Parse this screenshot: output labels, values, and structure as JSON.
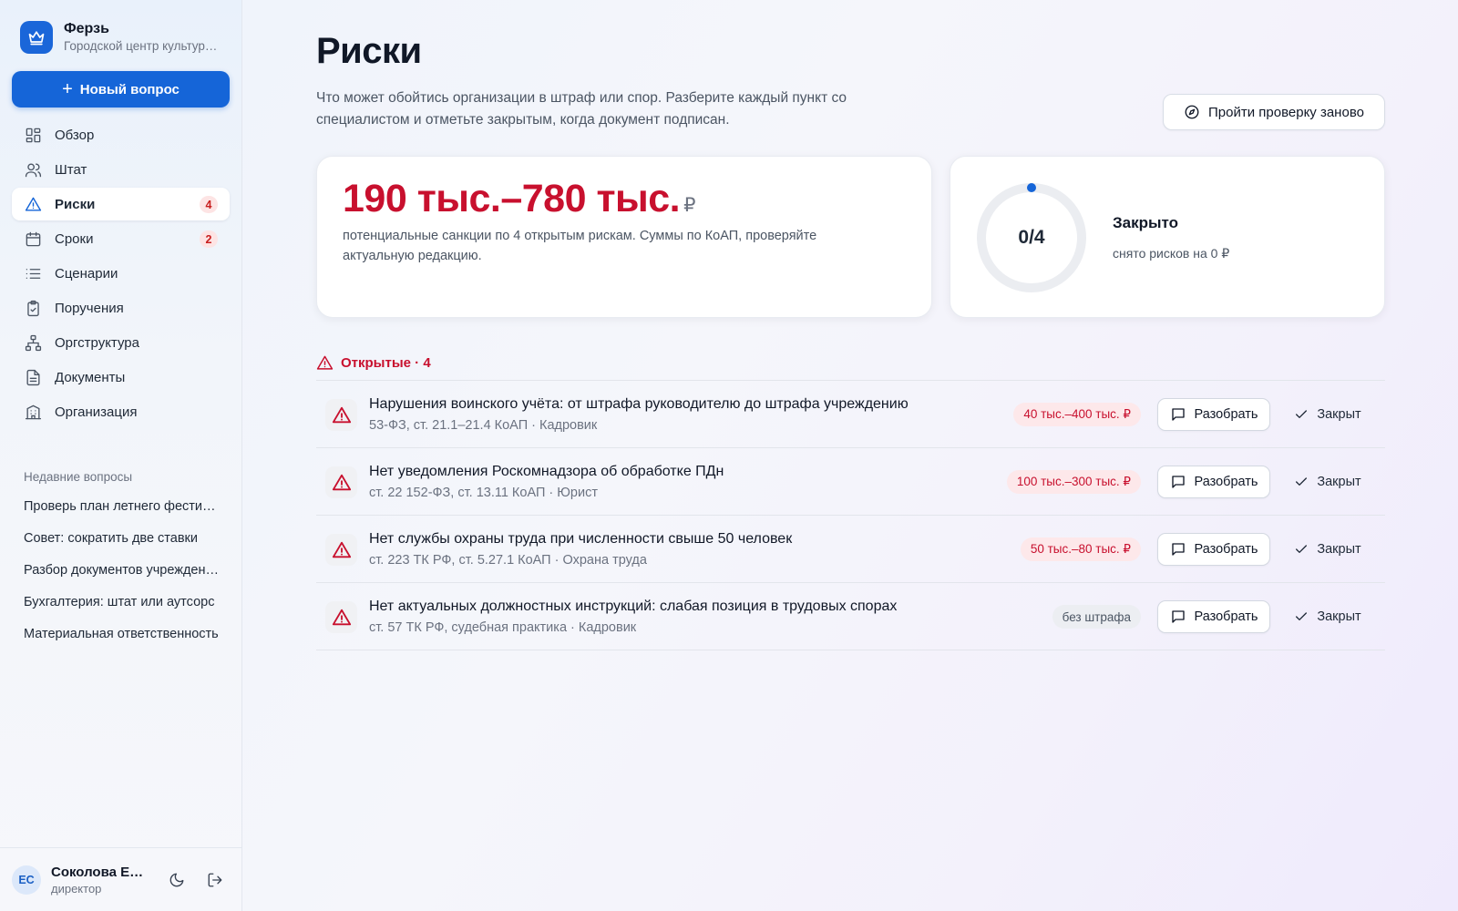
{
  "brand": {
    "name": "Ферзь",
    "subtitle": "Городской центр культуры и досуга"
  },
  "sidebar": {
    "new_question": "Новый вопрос",
    "nav": [
      {
        "label": "Обзор",
        "icon": "grid-icon",
        "badge": null,
        "active": false
      },
      {
        "label": "Штат",
        "icon": "users-icon",
        "badge": null,
        "active": false
      },
      {
        "label": "Риски",
        "icon": "warning-icon",
        "badge": "4",
        "active": true
      },
      {
        "label": "Сроки",
        "icon": "calendar-icon",
        "badge": "2",
        "active": false
      },
      {
        "label": "Сценарии",
        "icon": "list-icon",
        "badge": null,
        "active": false
      },
      {
        "label": "Поручения",
        "icon": "clipboard-icon",
        "badge": null,
        "active": false
      },
      {
        "label": "Оргструктура",
        "icon": "org-chart-icon",
        "badge": null,
        "active": false
      },
      {
        "label": "Документы",
        "icon": "document-icon",
        "badge": null,
        "active": false
      },
      {
        "label": "Организация",
        "icon": "building-icon",
        "badge": null,
        "active": false
      }
    ],
    "recent_title": "Недавние вопросы",
    "recent": [
      "Проверь план летнего фестиваля",
      "Совет: сократить две ставки",
      "Разбор документов учреждения",
      "Бухгалтерия: штат или аутсорс",
      "Материальная ответственность"
    ]
  },
  "user": {
    "initials": "ЕС",
    "name": "Соколова Елена",
    "role": "директор"
  },
  "page": {
    "title": "Риски",
    "description": "Что может обойтись организации в штраф или спор. Разберите каждый пункт со специалистом и отметьте закрытым, когда документ подписан.",
    "recheck_button": "Пройти проверку заново"
  },
  "summary": {
    "value": "190 тыс.–780 тыс.",
    "currency": "₽",
    "description": "потенциальные санкции по 4 открытым рискам. Суммы по КоАП, проверяйте актуальную редакцию."
  },
  "closed": {
    "ratio_text": "0/4",
    "closed_count": 0,
    "total_count": 4,
    "title": "Закрыто",
    "subtitle": "снято рисков на 0 ₽"
  },
  "section": {
    "label": "Открытые · 4"
  },
  "risks": [
    {
      "title": "Нарушения воинского учёта: от штрафа руководителю до штрафа учреждению",
      "sub": "53-ФЗ, ст. 21.1–21.4 КоАП · Кадровик",
      "fine": "40 тыс.–400 тыс. ₽",
      "fine_style": "danger",
      "analyze": "Разобрать",
      "close": "Закрыт"
    },
    {
      "title": "Нет уведомления Роскомнадзора об обработке ПДн",
      "sub": "ст. 22 152-ФЗ, ст. 13.11 КоАП · Юрист",
      "fine": "100 тыс.–300 тыс. ₽",
      "fine_style": "danger",
      "analyze": "Разобрать",
      "close": "Закрыт"
    },
    {
      "title": "Нет службы охраны труда при численности свыше 50 человек",
      "sub": "ст. 223 ТК РФ, ст. 5.27.1 КоАП · Охрана труда",
      "fine": "50 тыс.–80 тыс. ₽",
      "fine_style": "danger",
      "analyze": "Разобрать",
      "close": "Закрыт"
    },
    {
      "title": "Нет актуальных должностных инструкций: слабая позиция в трудовых спорах",
      "sub": "ст. 57 ТК РФ, судебная практика · Кадровик",
      "fine": "без штрафа",
      "fine_style": "neutral",
      "analyze": "Разобрать",
      "close": "Закрыт"
    }
  ],
  "colors": {
    "accent": "#1565d8",
    "danger": "#c8102e",
    "badge_bg": "#fde4e4"
  }
}
